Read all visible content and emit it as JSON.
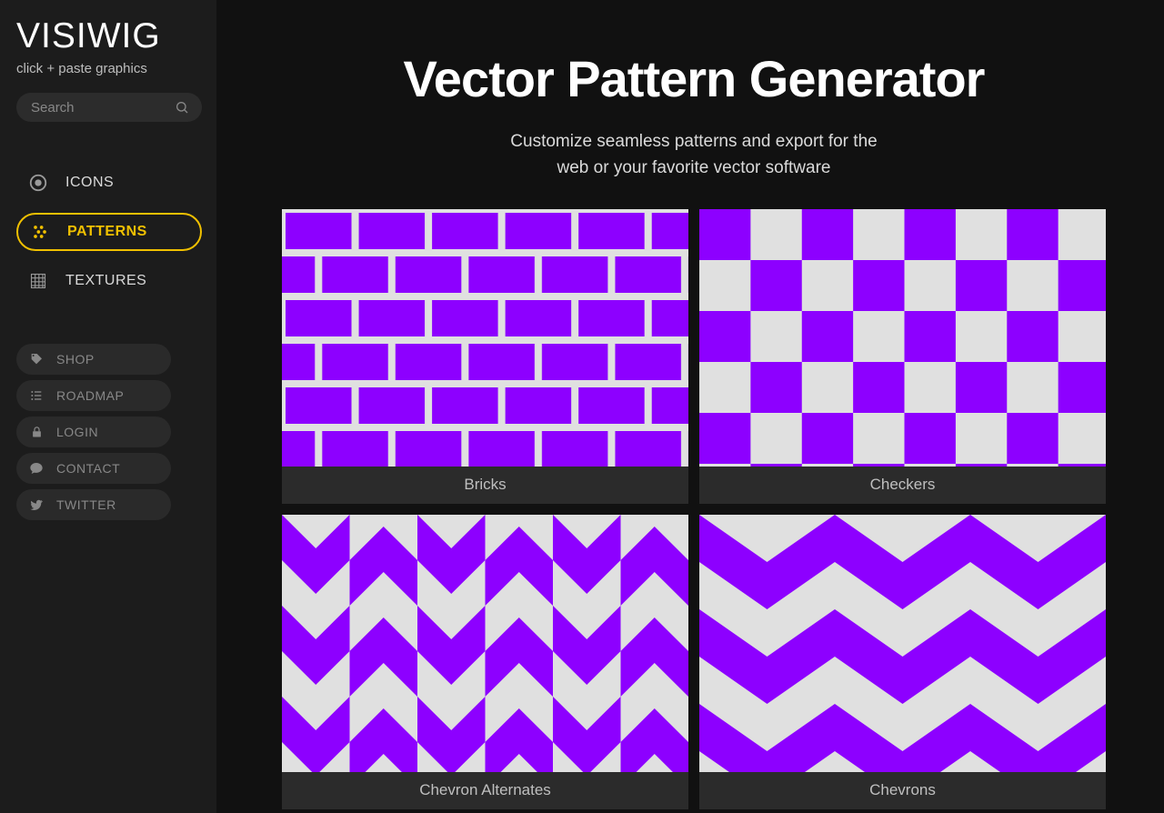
{
  "brand": {
    "logo": "VISIWIG",
    "tagline": "click + paste graphics"
  },
  "search": {
    "placeholder": "Search"
  },
  "nav": {
    "primary": [
      {
        "id": "icons",
        "label": "ICONS",
        "active": false
      },
      {
        "id": "patterns",
        "label": "PATTERNS",
        "active": true
      },
      {
        "id": "textures",
        "label": "TEXTURES",
        "active": false
      }
    ],
    "secondary": [
      {
        "id": "shop",
        "label": "SHOP"
      },
      {
        "id": "roadmap",
        "label": "ROADMAP"
      },
      {
        "id": "login",
        "label": "LOGIN"
      },
      {
        "id": "contact",
        "label": "CONTACT"
      },
      {
        "id": "twitter",
        "label": "TWITTER"
      }
    ]
  },
  "main": {
    "title": "Vector Pattern Generator",
    "subtitle_line1": "Customize seamless patterns and export for the",
    "subtitle_line2": "web or your favorite vector software"
  },
  "patterns": [
    {
      "id": "bricks",
      "label": "Bricks"
    },
    {
      "id": "checkers",
      "label": "Checkers"
    },
    {
      "id": "chevron-alternates",
      "label": "Chevron Alternates"
    },
    {
      "id": "chevrons",
      "label": "Chevrons"
    }
  ],
  "colors": {
    "accent": "#8d00ff",
    "light": "#e0e0e0",
    "highlight": "#f0c000"
  }
}
